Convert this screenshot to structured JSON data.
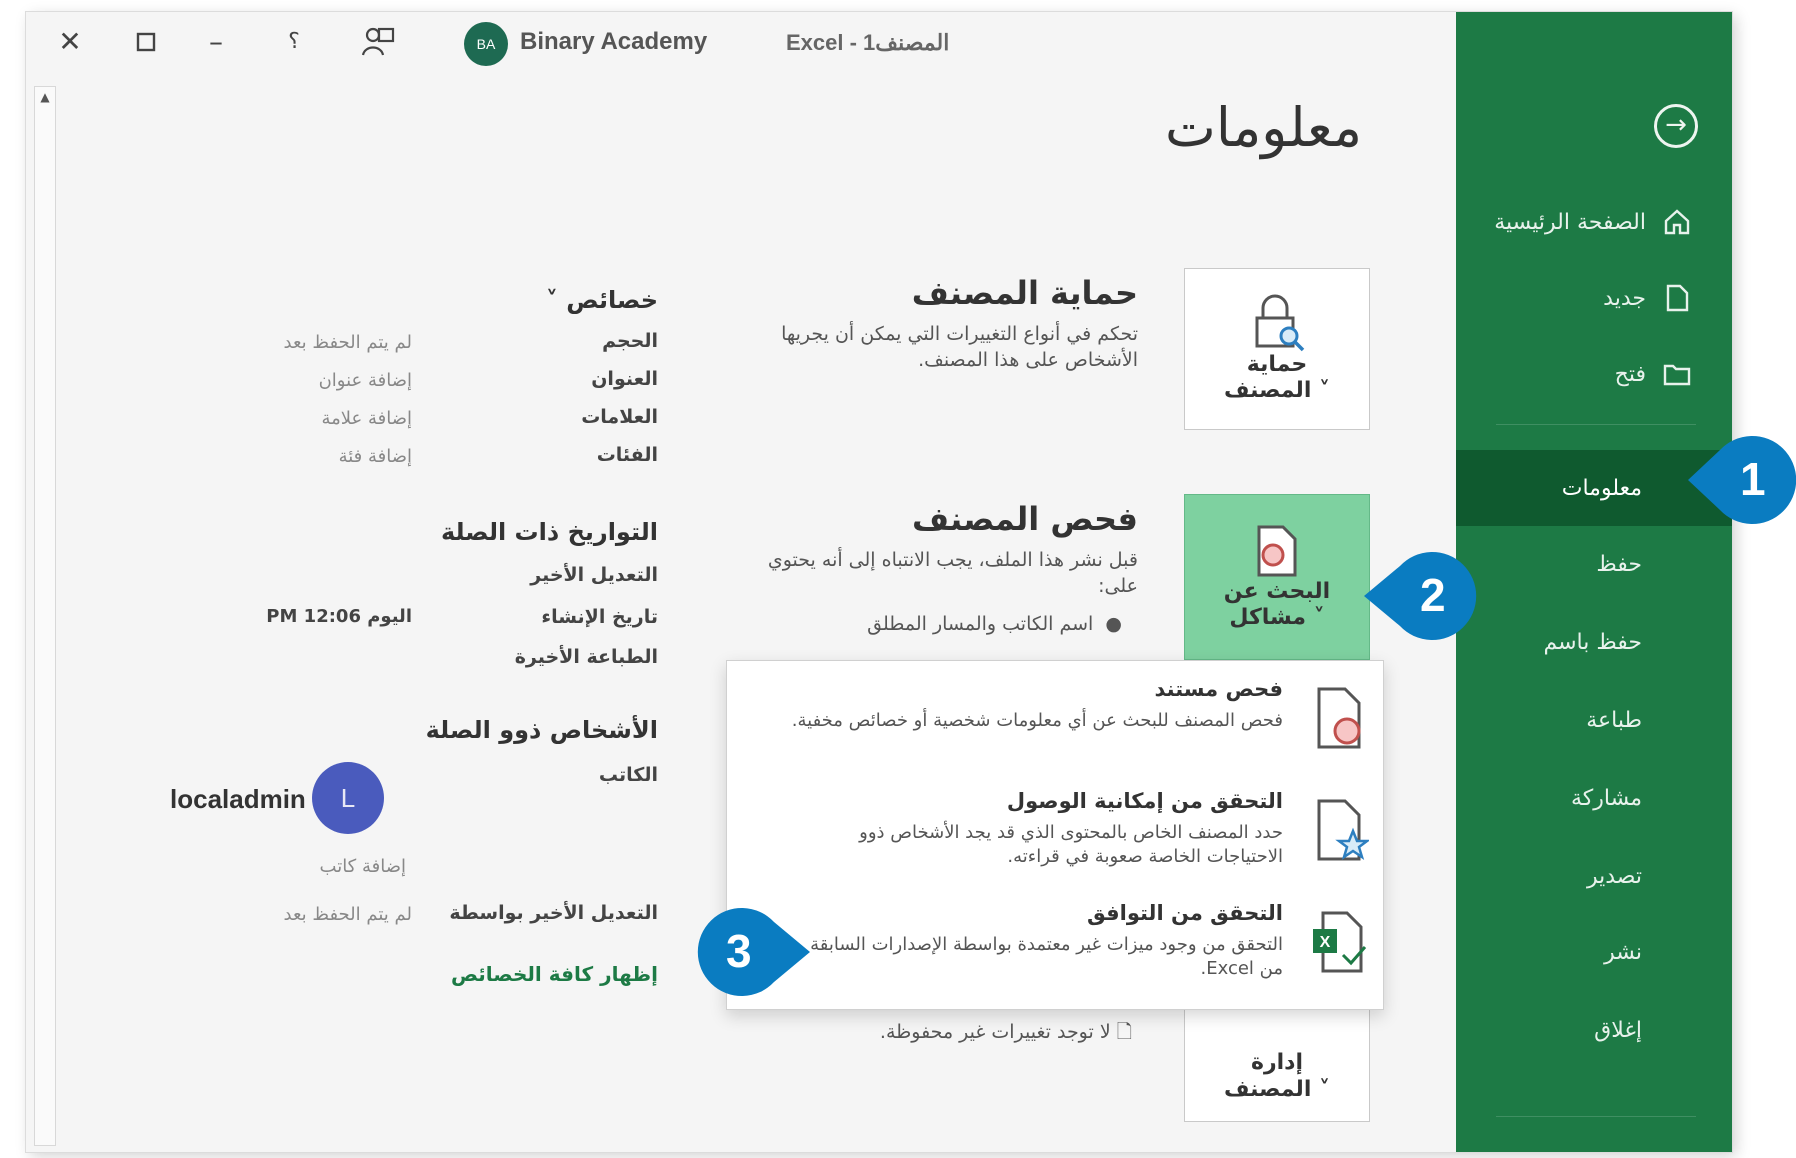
{
  "titlebar": {
    "user_initials": "BA",
    "user_name": "Binary Academy",
    "doc_title": "Excel - المصنف1"
  },
  "sidebar": {
    "items": [
      {
        "label": "الصفحة الرئيسية",
        "icon": "home-icon"
      },
      {
        "label": "جديد",
        "icon": "new-file-icon"
      },
      {
        "label": "فتح",
        "icon": "open-folder-icon"
      },
      {
        "label": "معلومات"
      },
      {
        "label": "حفظ"
      },
      {
        "label": "حفظ باسم"
      },
      {
        "label": "طباعة"
      },
      {
        "label": "مشاركة"
      },
      {
        "label": "تصدير"
      },
      {
        "label": "نشر"
      },
      {
        "label": "إغلاق"
      }
    ],
    "active_index": 3
  },
  "main": {
    "title": "معلومات",
    "protect": {
      "button_label_1": "حماية",
      "button_label_2": "المصنف ˅",
      "title": "حماية المصنف",
      "desc": "تحكم في أنواع التغييرات التي يمكن أن يجريها الأشخاص على هذا المصنف."
    },
    "inspect": {
      "button_label_1": "البحث عن",
      "button_label_2": "مشاكل ˅",
      "title": "فحص المصنف",
      "desc": "قبل نشر هذا الملف، يجب الانتباه إلى أنه يحتوي على:",
      "bullet": "اسم الكاتب والمسار المطلق"
    },
    "manage": {
      "button_label_1": "إدارة",
      "button_label_2": "المصنف ˅",
      "desc": "لا توجد تغييرات غير محفوظة."
    }
  },
  "dropdown": {
    "items": [
      {
        "title": "فحص مستند",
        "desc": "فحص المصنف للبحث عن أي معلومات شخصية أو خصائص مخفية."
      },
      {
        "title": "التحقق من إمكانية الوصول",
        "desc": "حدد المصنف الخاص بالمحتوى الذي قد يجد الأشخاص ذوو الاحتياجات الخاصة صعوبة في قراءته."
      },
      {
        "title": "التحقق من التوافق",
        "desc": "التحقق من وجود ميزات غير معتمدة بواسطة الإصدارات السابقة من Excel."
      }
    ]
  },
  "properties": {
    "heading": "خصائص ˅",
    "rows": [
      {
        "label": "الحجم",
        "value": "لم يتم الحفظ بعد"
      },
      {
        "label": "العنوان",
        "value": "إضافة عنوان"
      },
      {
        "label": "العلامات",
        "value": "إضافة علامة"
      },
      {
        "label": "الفئات",
        "value": "إضافة فئة"
      }
    ],
    "dates_heading": "التواريخ ذات الصلة",
    "dates": [
      {
        "label": "التعديل الأخير",
        "value": ""
      },
      {
        "label": "تاريخ الإنشاء",
        "value": "اليوم PM 12:06"
      },
      {
        "label": "الطباعة الأخيرة",
        "value": ""
      }
    ],
    "people_heading": "الأشخاص ذوو الصلة",
    "author_label": "الكاتب",
    "author_initial": "L",
    "author_name": "localadmin",
    "add_author": "إضافة كاتب",
    "last_modified_by_label": "التعديل الأخير بواسطة",
    "last_modified_by_value": "لم يتم الحفظ بعد",
    "show_all": "إظهار كافة الخصائص"
  },
  "callouts": [
    "1",
    "2",
    "3"
  ],
  "colors": {
    "sidebar": "#1d7a45",
    "sidebar_active": "#0f5a2f",
    "callout": "#0a7cc1",
    "active_button": "#7ed1a0"
  }
}
